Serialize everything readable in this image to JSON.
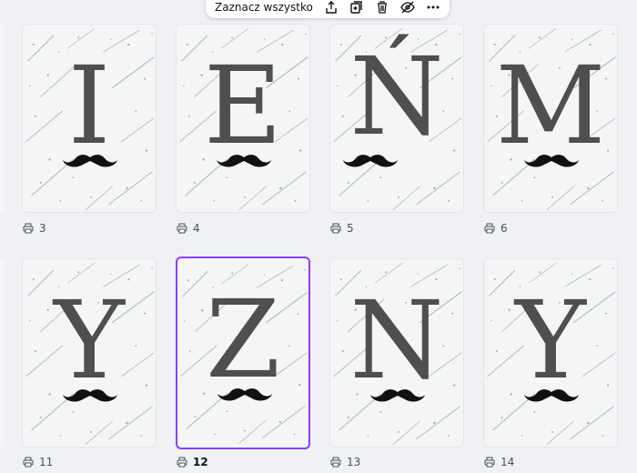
{
  "toolbar": {
    "select_all_label": "Zaznacz wszystko",
    "icons": [
      "share-icon",
      "duplicate-add-icon",
      "trash-icon",
      "hide-eye-icon",
      "more-icon"
    ]
  },
  "pages": [
    {
      "letter": "I",
      "number": "3",
      "selected": false
    },
    {
      "letter": "E",
      "number": "4",
      "selected": false
    },
    {
      "letter": "Ń",
      "number": "5",
      "selected": false
    },
    {
      "letter": "M",
      "number": "6",
      "selected": false
    },
    {
      "letter": "Y",
      "number": "11",
      "selected": false
    },
    {
      "letter": "Z",
      "number": "12",
      "selected": true
    },
    {
      "letter": "N",
      "number": "13",
      "selected": false
    },
    {
      "letter": "Y",
      "number": "14",
      "selected": false
    }
  ],
  "colors": {
    "accent": "#8b3dff",
    "letter": "#4f4f4f",
    "background": "#f0f1f5"
  }
}
